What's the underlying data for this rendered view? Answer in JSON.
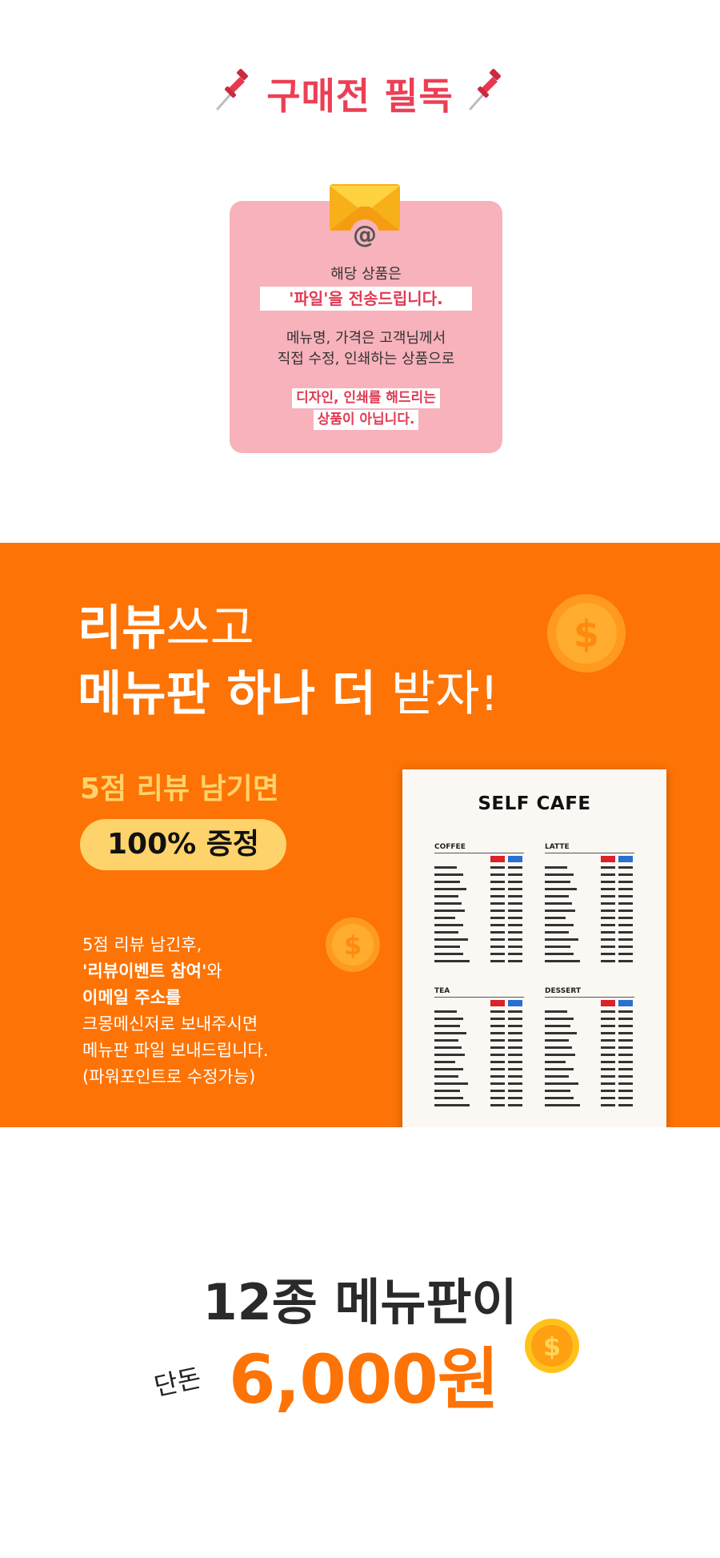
{
  "notice": {
    "title": "구매전 필독",
    "line1": "해당 상품은",
    "highlight1": "'파일'을 전송드립니다.",
    "line2": "메뉴명, 가격은 고객님께서",
    "line3": "직접 수정, 인쇄하는 상품으로",
    "highlight2a": "디자인, 인쇄를 해드리는",
    "highlight2b": "상품이 아닙니다."
  },
  "promo": {
    "head1_bold": "리뷰",
    "head1_light": "쓰고",
    "head2_bold": "메뉴판 하나 더",
    "head2_light": " 받자!",
    "review_label": "5점 리뷰 남기면",
    "gift": "100% 증정",
    "text": {
      "l1": "5점 리뷰 남긴후,",
      "l2_bold": "'리뷰이벤트 참여'",
      "l2_rest": "와",
      "l3": "이메일 주소를",
      "l4": "크몽메신저로 보내주시면",
      "l5": "메뉴판 파일 보내드립니다.",
      "l6": "(파워포인트로 수정가능)"
    },
    "coin_symbol": "$",
    "menu_board": {
      "title": "SELF CAFE",
      "sections": [
        "COFFEE",
        "LATTE",
        "TEA",
        "DESSERT"
      ]
    }
  },
  "price": {
    "line1": "12종 메뉴판이",
    "prefix": "단돈",
    "amount": "6,000원"
  },
  "colors": {
    "accent_red": "#ec3f55",
    "orange": "#fd7305",
    "yellow": "#ffd36b",
    "card_pink": "#f7b2bb"
  }
}
